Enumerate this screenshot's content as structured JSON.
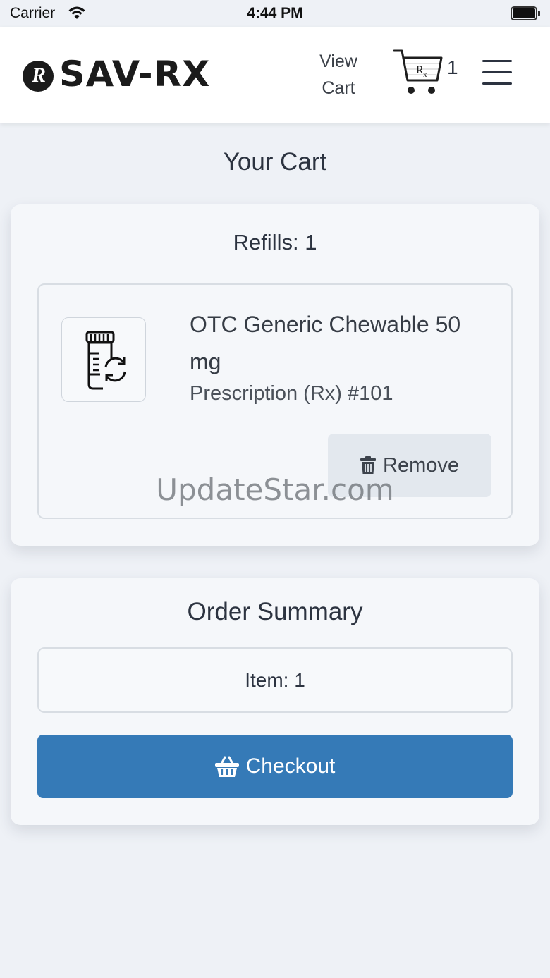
{
  "status_bar": {
    "carrier": "Carrier",
    "time": "4:44 PM"
  },
  "header": {
    "logo_text": "SAV-RX",
    "view_cart_line1": "View",
    "view_cart_line2": "Cart",
    "cart_count": "1",
    "menu_icon": "hamburger-icon"
  },
  "page": {
    "title": "Your Cart"
  },
  "refills": {
    "heading": "Refills: 1",
    "items": [
      {
        "name": "OTC Generic Chewable 50 mg",
        "rx": "Prescription (Rx) #101",
        "icon": "pill-bottle-refill-icon",
        "remove_label": "Remove"
      }
    ]
  },
  "summary": {
    "heading": "Order Summary",
    "item_count": "Item: 1",
    "checkout_label": "Checkout"
  },
  "watermark": "UpdateStar.com",
  "colors": {
    "primary": "#357ab7",
    "background": "#eef1f6",
    "card": "#f5f7fa"
  }
}
